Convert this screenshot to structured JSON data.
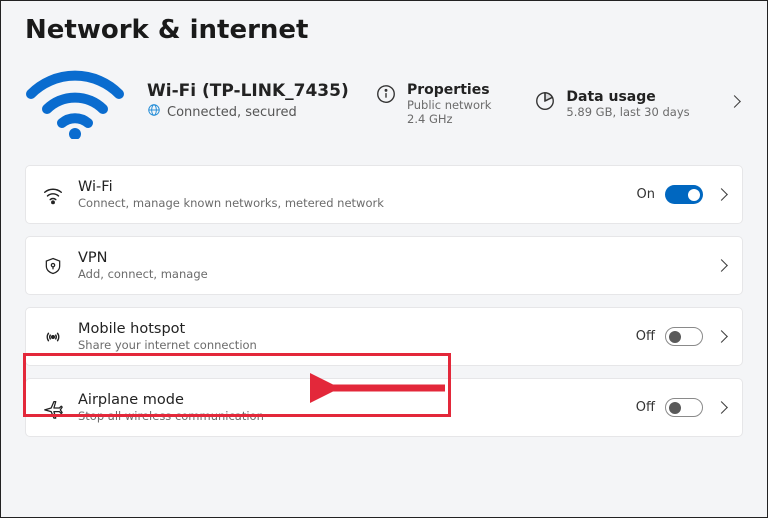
{
  "page": {
    "title": "Network & internet"
  },
  "hero": {
    "ssid": "Wi-Fi (TP-LINK_7435)",
    "status": "Connected, secured",
    "properties": {
      "title": "Properties",
      "line1": "Public network",
      "line2": "2.4 GHz"
    },
    "data_usage": {
      "title": "Data usage",
      "line1": "5.89 GB, last 30 days"
    }
  },
  "rows": {
    "wifi": {
      "title": "Wi-Fi",
      "sub": "Connect, manage known networks, metered network",
      "state": "On"
    },
    "vpn": {
      "title": "VPN",
      "sub": "Add, connect, manage"
    },
    "hotspot": {
      "title": "Mobile hotspot",
      "sub": "Share your internet connection",
      "state": "Off"
    },
    "airplane": {
      "title": "Airplane mode",
      "sub": "Stop all wireless communication",
      "state": "Off"
    }
  }
}
